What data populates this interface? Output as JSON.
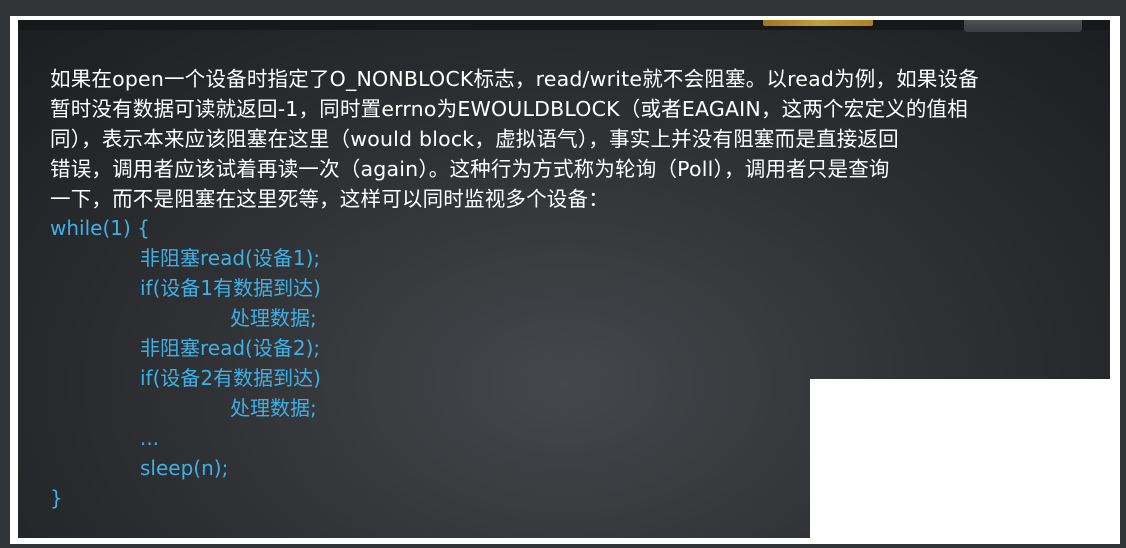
{
  "paragraph_lines": [
    "如果在open一个设备时指定了O_NONBLOCK标志，read/write就不会阻塞。以read为例，如果设备",
    "暂时没有数据可读就返回-1，同时置errno为EWOULDBLOCK（或者EAGAIN，这两个宏定义的值相",
    "同），表示本来应该阻塞在这里（would block，虚拟语气），事实上并没有阻塞而是直接返回",
    "错误，调用者应该试着再读一次（again）。这种行为方式称为轮询（Poll），调用者只是查询",
    "一下，而不是阻塞在这里死等，这样可以同时监视多个设备："
  ],
  "code_lines": [
    "while(1) {",
    "非阻塞read(设备1);",
    "if(设备1有数据到达)",
    "处理数据;",
    "非阻塞read(设备2);",
    "if(设备2有数据到达)",
    "处理数据;",
    "...",
    "sleep(n);",
    "}"
  ],
  "colors": {
    "text": "#ffffff",
    "code": "#3fb0e6",
    "background": "#2e3033"
  }
}
